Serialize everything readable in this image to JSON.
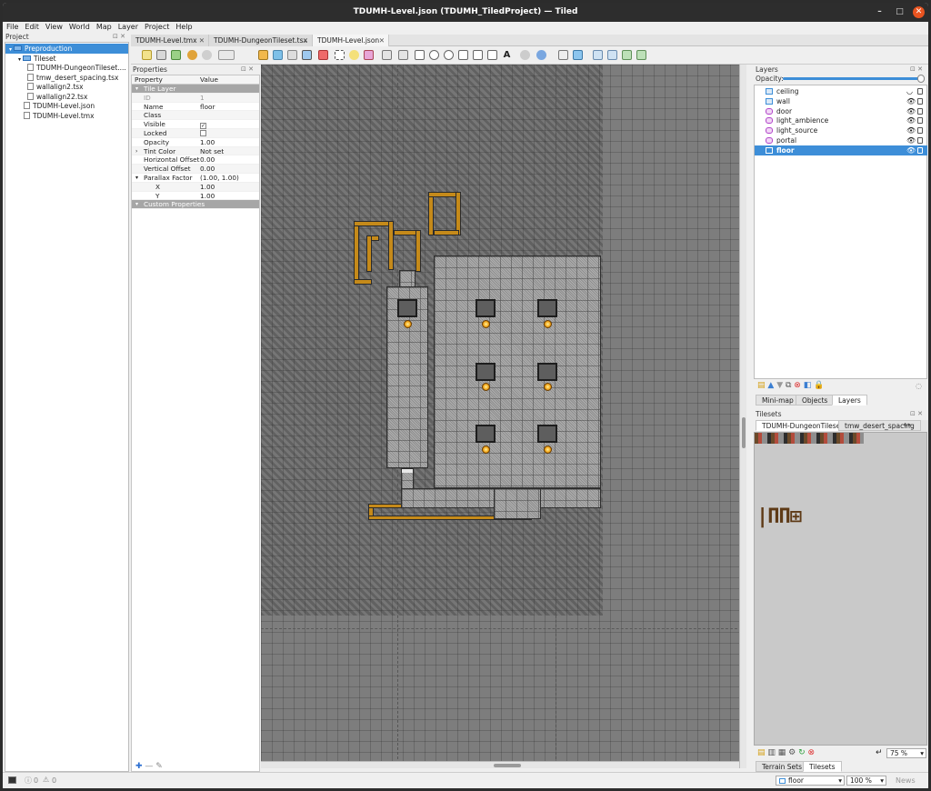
{
  "window": {
    "title": "TDUMH-Level.json (TDUMH_TiledProject) — Tiled"
  },
  "menu": [
    "File",
    "Edit",
    "View",
    "World",
    "Map",
    "Layer",
    "Project",
    "Help"
  ],
  "project": {
    "title": "Project",
    "items": [
      {
        "label": "Preproduction",
        "level": 0,
        "type": "folder",
        "selected": true
      },
      {
        "label": "Tileset",
        "level": 1,
        "type": "folder"
      },
      {
        "label": "TDUMH-DungeonTileset....",
        "level": 2,
        "type": "file"
      },
      {
        "label": "tmw_desert_spacing.tsx",
        "level": 2,
        "type": "file"
      },
      {
        "label": "wallalign2.tsx",
        "level": 2,
        "type": "file"
      },
      {
        "label": "wallalign22.tsx",
        "level": 2,
        "type": "file"
      },
      {
        "label": "TDUMH-Level.json",
        "level": 1,
        "type": "file"
      },
      {
        "label": "TDUMH-Level.tmx",
        "level": 1,
        "type": "file"
      }
    ]
  },
  "tabs": [
    {
      "label": "TDUMH-Level.tmx"
    },
    {
      "label": "TDUMH-DungeonTileset.tsx"
    },
    {
      "label": "TDUMH-Level.json",
      "active": true
    }
  ],
  "properties": {
    "title": "Properties",
    "col_property": "Property",
    "col_value": "Value",
    "rows": [
      {
        "k": "Tile Layer",
        "v": "",
        "group": true,
        "arrow": "▾"
      },
      {
        "k": "ID",
        "v": "1",
        "dim": true
      },
      {
        "k": "Name",
        "v": "floor"
      },
      {
        "k": "Class",
        "v": ""
      },
      {
        "k": "Visible",
        "v": "",
        "check": "✓"
      },
      {
        "k": "Locked",
        "v": "",
        "check": ""
      },
      {
        "k": "Opacity",
        "v": "1.00"
      },
      {
        "k": "Tint Color",
        "v": "Not set",
        "arrow": "›"
      },
      {
        "k": "Horizontal Offset",
        "v": "0.00"
      },
      {
        "k": "Vertical Offset",
        "v": "0.00"
      },
      {
        "k": "Parallax Factor",
        "v": "(1.00, 1.00)",
        "arrow": "▾"
      },
      {
        "k": "X",
        "v": "1.00",
        "indent": true
      },
      {
        "k": "Y",
        "v": "1.00",
        "indent": true
      },
      {
        "k": "Custom Properties",
        "v": "",
        "group": true,
        "arrow": "▾"
      }
    ]
  },
  "layers": {
    "title": "Layers",
    "opacity_label": "Opacity:",
    "opacity_value": 1.0,
    "items": [
      {
        "name": "ceiling",
        "type": "tile",
        "eye": "◡"
      },
      {
        "name": "wall",
        "type": "tile",
        "eye": "👁"
      },
      {
        "name": "door",
        "type": "object",
        "eye": "👁"
      },
      {
        "name": "light_ambience",
        "type": "object",
        "eye": "👁"
      },
      {
        "name": "light_source",
        "type": "object",
        "eye": "👁"
      },
      {
        "name": "portal",
        "type": "object",
        "eye": "👁"
      },
      {
        "name": "floor",
        "type": "tile",
        "eye": "👁",
        "selected": true
      }
    ],
    "tabs": [
      {
        "label": "Mini-map"
      },
      {
        "label": "Objects"
      },
      {
        "label": "Layers",
        "active": true
      }
    ]
  },
  "tilesets": {
    "title": "Tilesets",
    "tabs": [
      {
        "label": "TDUMH-DungeonTileset",
        "active": true
      },
      {
        "label": "tmw_desert_spacing"
      }
    ],
    "zoom": "75 %",
    "bottom_tabs": [
      {
        "label": "Terrain Sets"
      },
      {
        "label": "Tilesets",
        "active": true
      }
    ]
  },
  "status": {
    "errors": "0",
    "warnings": "0",
    "layer": "floor",
    "zoom": "100 %",
    "news": "News"
  },
  "colors": {
    "selection": "#3d8ed8",
    "wall": "#c58a1a",
    "titlebar": "#2d2d2d"
  }
}
